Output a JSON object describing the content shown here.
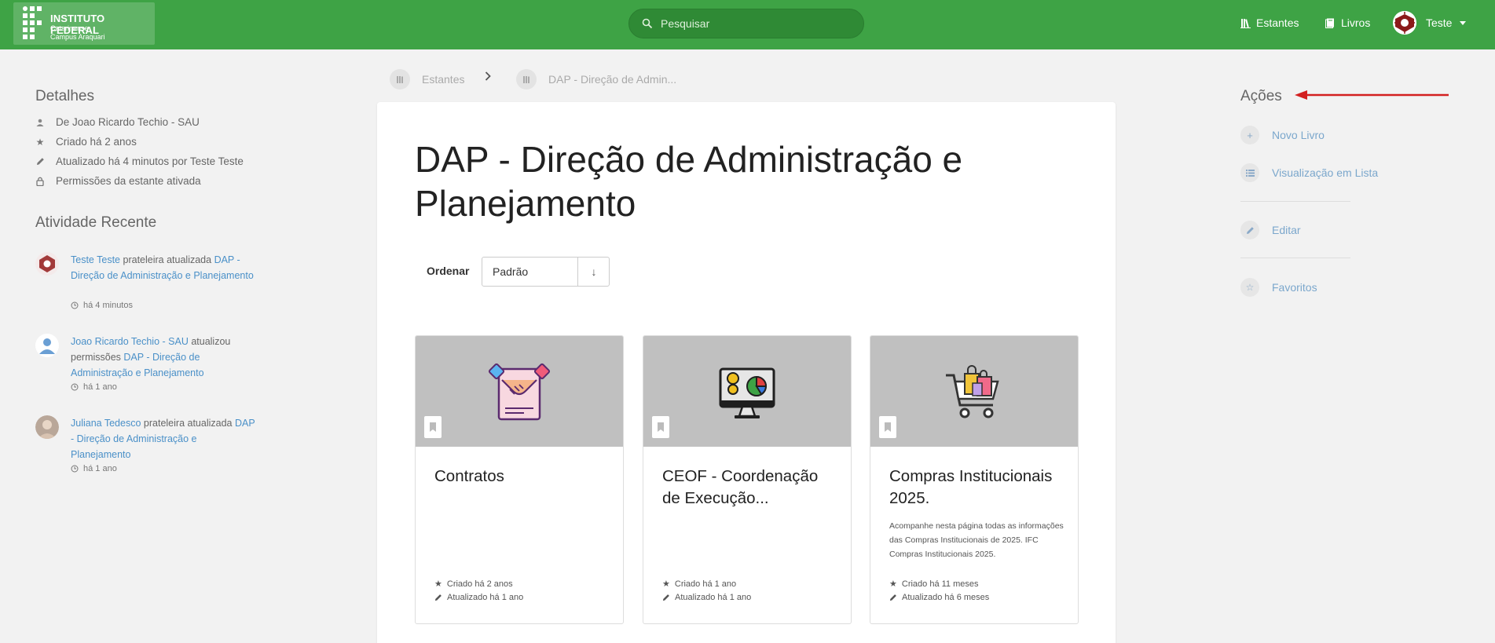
{
  "header": {
    "logo": {
      "line1": "INSTITUTO FEDERAL",
      "line2": "Catarinense",
      "line3": "Campus Araquari"
    },
    "search_placeholder": "Pesquisar",
    "nav": [
      {
        "label": "Estantes",
        "icon": "bookshelf-icon"
      },
      {
        "label": "Livros",
        "icon": "books-icon"
      }
    ],
    "user_name": "Teste"
  },
  "details": {
    "title": "Detalhes",
    "items": [
      {
        "icon": "user-icon",
        "text": "De Joao Ricardo Techio - SAU"
      },
      {
        "icon": "star-icon",
        "text": "Criado há 2 anos"
      },
      {
        "icon": "pencil-icon",
        "text": "Atualizado há 4 minutos por Teste Teste"
      },
      {
        "icon": "lock-icon",
        "text": "Permissões da estante ativada"
      }
    ]
  },
  "activity": {
    "title": "Atividade Recente",
    "items": [
      {
        "user": "Teste Teste",
        "action": "prateleira atualizada",
        "target": "DAP - Direção de Administração e Planejamento",
        "time": "há 4 minutos"
      },
      {
        "user": "Joao Ricardo Techio - SAU",
        "action": "atualizou permissões",
        "target": "DAP - Direção de Administração e Planejamento",
        "time": "há 1 ano"
      },
      {
        "user": "Juliana Tedesco",
        "action": "prateleira atualizada",
        "target": "DAP - Direção de Administração e Planejamento",
        "time": "há 1 ano"
      }
    ]
  },
  "breadcrumb": [
    {
      "label": "Estantes"
    },
    {
      "label": "DAP - Direção de Admin..."
    }
  ],
  "main": {
    "title": "DAP - Direção de Administração e Planejamento",
    "sort_label": "Ordenar",
    "sort_value": "Padrão",
    "sort_direction": "↓"
  },
  "books": [
    {
      "title": "Contratos",
      "description": "",
      "created": "Criado há 2 anos",
      "updated": "Atualizado há 1 ano"
    },
    {
      "title": "CEOF - Coordenação de Execução...",
      "description": "",
      "created": "Criado há 1 ano",
      "updated": "Atualizado há 1 ano"
    },
    {
      "title": "Compras Institucionais 2025.",
      "description": "Acompanhe nesta página todas as informações das Compras Institucionais de 2025. IFC Compras Institucionais 2025.",
      "created": "Criado há 11 meses",
      "updated": "Atualizado há 6 meses"
    }
  ],
  "actions": {
    "title": "Ações",
    "items": [
      {
        "label": "Novo Livro",
        "icon": "plus-icon"
      },
      {
        "label": "Visualização em Lista",
        "icon": "list-icon"
      },
      {
        "label": "Editar",
        "icon": "pencil-icon"
      },
      {
        "label": "Favoritos",
        "icon": "star-outline-icon"
      }
    ]
  },
  "colors": {
    "header": "#3ea345",
    "link": "#4a90c8",
    "arrow": "#d32020"
  }
}
